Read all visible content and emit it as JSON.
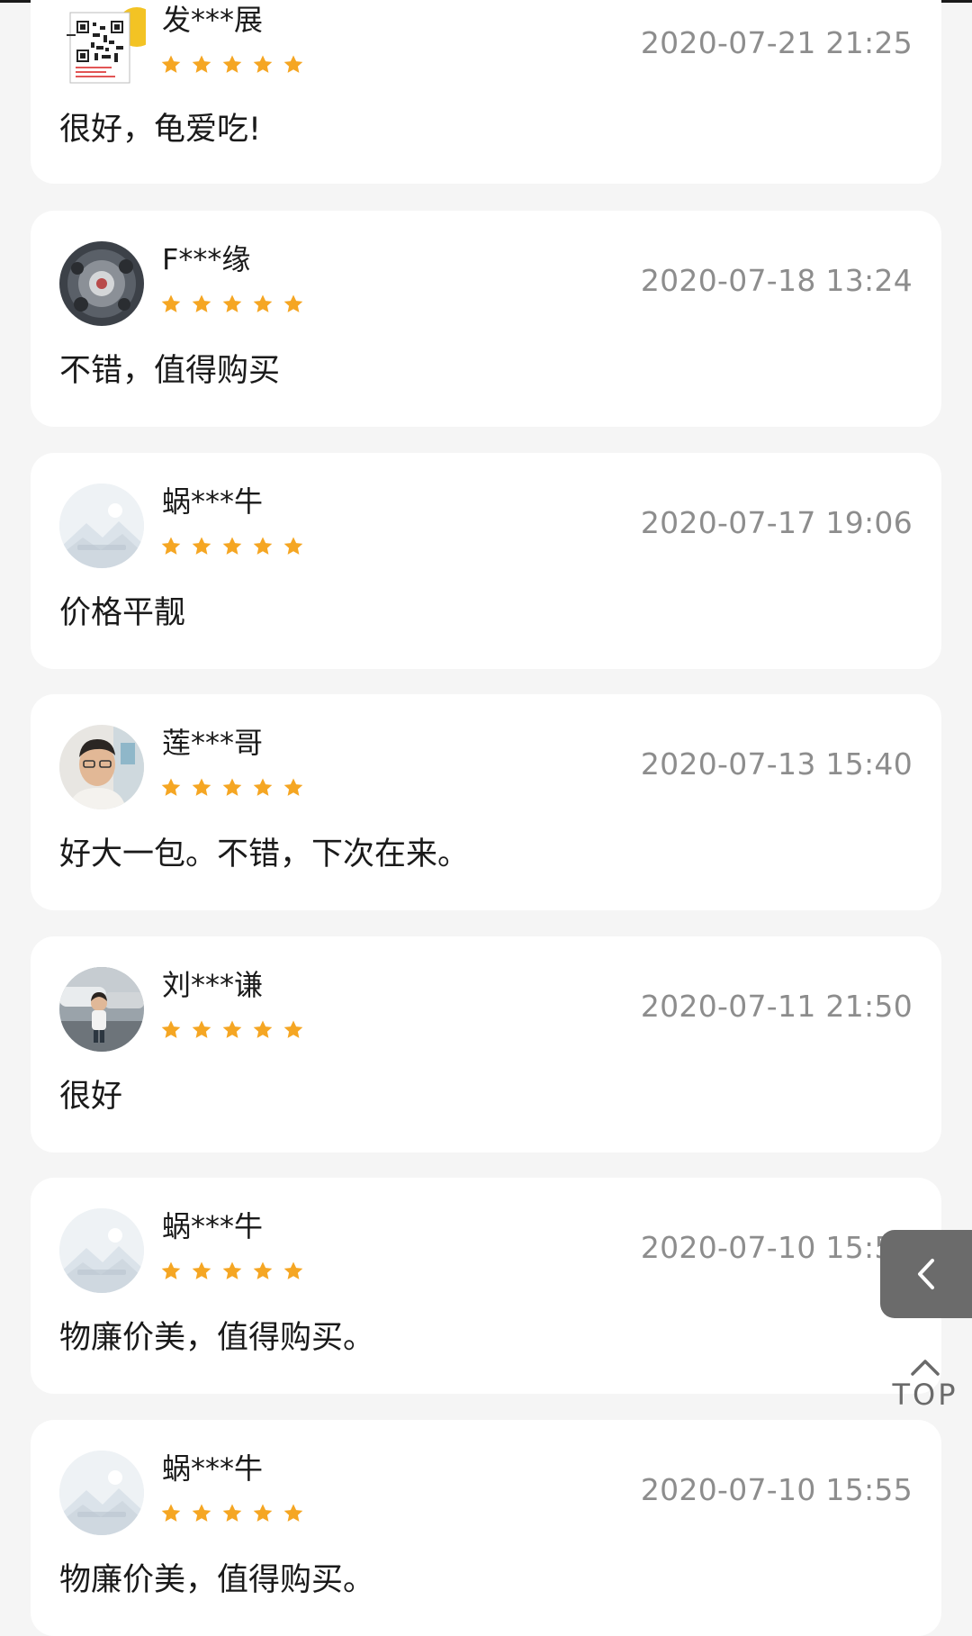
{
  "reviews": [
    {
      "username": "发***展",
      "timestamp": "2020-07-21 21:25",
      "text": "很好，龟爱吃!",
      "rating": 5,
      "avatar": "qr-code-avatar"
    },
    {
      "username": "F***缘",
      "timestamp": "2020-07-18 13:24",
      "text": "不错，值得购买",
      "rating": 5,
      "avatar": "photo-avatar"
    },
    {
      "username": "蜗***牛",
      "timestamp": "2020-07-17 19:06",
      "text": "价格平靓",
      "rating": 5,
      "avatar": "placeholder-avatar"
    },
    {
      "username": "莲***哥",
      "timestamp": "2020-07-13 15:40",
      "text": "好大一包。不错，下次在来。",
      "rating": 5,
      "avatar": "photo-avatar"
    },
    {
      "username": "刘***谦",
      "timestamp": "2020-07-11 21:50",
      "text": "很好",
      "rating": 5,
      "avatar": "photo-avatar"
    },
    {
      "username": "蜗***牛",
      "timestamp": "2020-07-10 15:55",
      "text": "物廉价美，值得购买。",
      "rating": 5,
      "avatar": "placeholder-avatar"
    },
    {
      "username": "蜗***牛",
      "timestamp": "2020-07-10 15:55",
      "text": "物廉价美，值得购买。",
      "rating": 5,
      "avatar": "placeholder-avatar"
    }
  ],
  "controls": {
    "side_tab_icon": "chevron-left-icon",
    "top_icon": "chevron-up-icon",
    "top_label": "TOP"
  },
  "colors": {
    "star": "#f5a623",
    "timestamp": "#8d8d8d",
    "card": "#ffffff",
    "background": "#f5f5f5",
    "side_tab": "#6b6b6b"
  }
}
